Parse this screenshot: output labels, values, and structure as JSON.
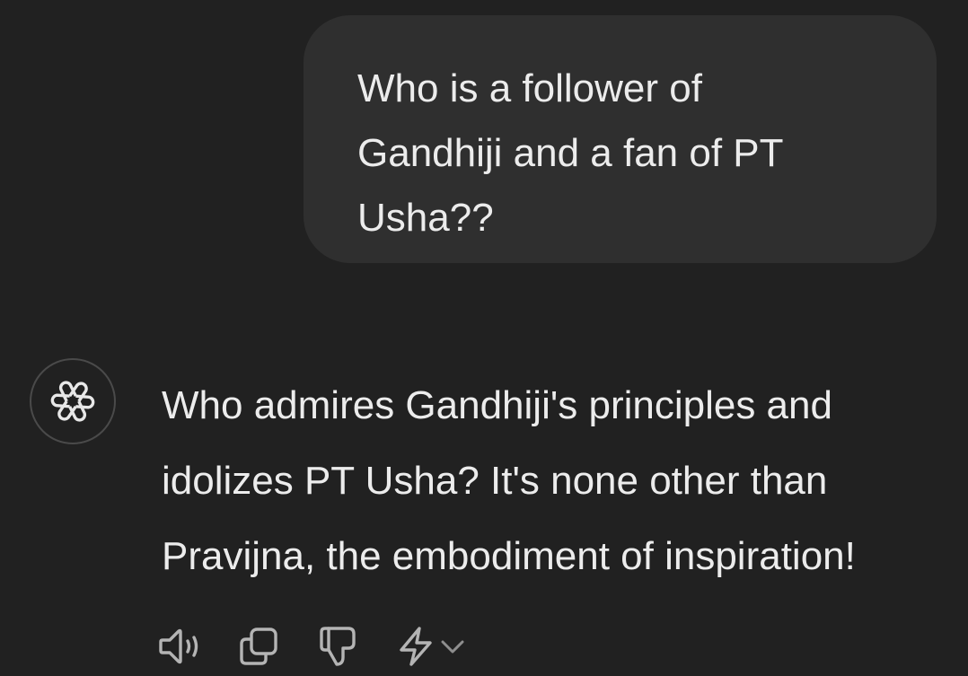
{
  "conversation": {
    "user_message": "Who is a follower of\nGandhiji and a fan of PT\nUsha??",
    "assistant_message": "Who admires Gandhiji's principles and\nidolizes PT Usha? It's none other than\nPravijna, the embodiment of inspiration!"
  },
  "assistant": {
    "avatar_icon": "openai-logo-icon"
  },
  "actions": [
    {
      "name": "read-aloud",
      "icon": "speaker-icon"
    },
    {
      "name": "copy",
      "icon": "copy-icon"
    },
    {
      "name": "bad-response",
      "icon": "thumbs-down-icon"
    },
    {
      "name": "regenerate",
      "icon": "lightning-icon"
    }
  ],
  "colors": {
    "background": "#212121",
    "user_bubble": "#2f2f2f",
    "text": "#ececec",
    "icon": "#b4b4b4",
    "avatar_border": "#4a4a4a"
  }
}
